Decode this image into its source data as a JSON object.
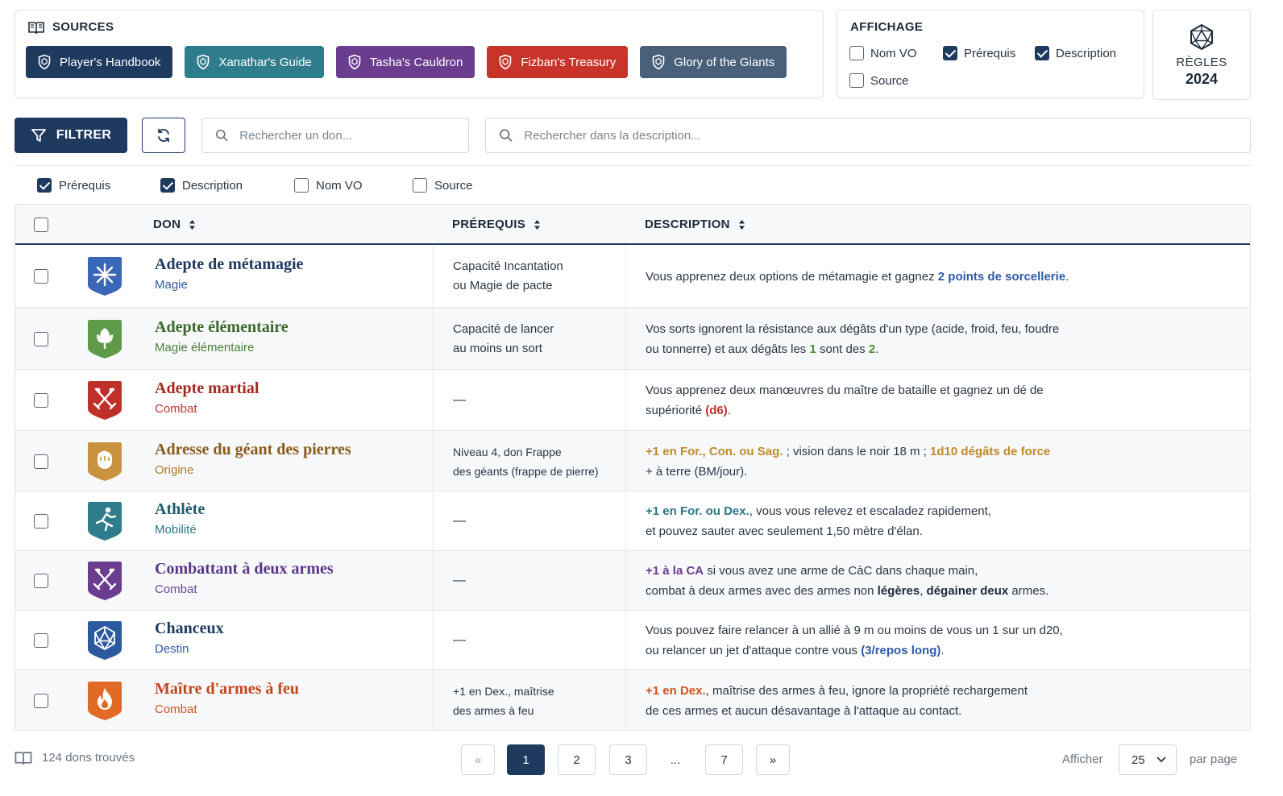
{
  "sources": {
    "title": "SOURCES",
    "buttons": [
      {
        "label": "Player's Handbook",
        "color": "#1f3a5f"
      },
      {
        "label": "Xanathar's Guide",
        "color": "#2f7d8c"
      },
      {
        "label": "Tasha's Cauldron",
        "color": "#6a3d8f"
      },
      {
        "label": "Fizban's Treasury",
        "color": "#c9342a"
      },
      {
        "label": "Glory of the Giants",
        "color": "#48607a"
      }
    ]
  },
  "affichage": {
    "title": "AFFICHAGE",
    "options": [
      {
        "label": "Nom VO",
        "checked": false
      },
      {
        "label": "Prérequis",
        "checked": true
      },
      {
        "label": "Description",
        "checked": true
      },
      {
        "label": "Source",
        "checked": false
      }
    ]
  },
  "regles": {
    "label": "RÈGLES",
    "year": "2024"
  },
  "toolbar": {
    "filter_label": "FILTRER",
    "search_don_placeholder": "Rechercher un don...",
    "search_desc_placeholder": "Rechercher dans la description..."
  },
  "column_toggles": [
    {
      "label": "Prérequis",
      "checked": true
    },
    {
      "label": "Description",
      "checked": true
    },
    {
      "label": "Nom VO",
      "checked": false
    },
    {
      "label": "Source",
      "checked": false
    }
  ],
  "table": {
    "headers": {
      "don": "DON",
      "prerequis": "PRÉREQUIS",
      "description": "DESCRIPTION"
    },
    "rows": [
      {
        "name": "Adepte de métamagie",
        "category": "Magie",
        "name_color": "#1f3a5f",
        "cat_color": "#2f5aa8",
        "icon_color": "#3b67b8",
        "icon": "sparkle-icon",
        "prereq": [
          "Capacité Incantation",
          "ou Magie de pacte"
        ],
        "desc": [
          [
            {
              "t": "Vous apprenez deux options de métamagie et gagnez "
            },
            {
              "t": "2 points de sorcellerie",
              "c": "#2f5aa8"
            },
            {
              "t": "."
            }
          ]
        ]
      },
      {
        "name": "Adepte élémentaire",
        "category": "Magie élémentaire",
        "name_color": "#3c6a2c",
        "cat_color": "#4b7f36",
        "icon_color": "#5e9a48",
        "icon": "leaf-icon",
        "prereq": [
          "Capacité de lancer",
          "au moins un sort"
        ],
        "desc": [
          [
            {
              "t": "Vos sorts ignorent la résistance aux dégâts d'un type (acide, froid, feu, foudre"
            }
          ],
          [
            {
              "t": "ou tonnerre) et aux dégâts les "
            },
            {
              "t": "1",
              "c": "#4b8f36"
            },
            {
              "t": " sont des "
            },
            {
              "t": "2",
              "c": "#4b8f36"
            },
            {
              "t": "."
            }
          ]
        ]
      },
      {
        "name": "Adepte martial",
        "category": "Combat",
        "name_color": "#a32a22",
        "cat_color": "#b8362c",
        "icon_color": "#c0302a",
        "icon": "crossed-swords-icon",
        "prereq": [
          "—"
        ],
        "desc": [
          [
            {
              "t": "Vous apprenez deux manœuvres du maître de bataille et gagnez un dé de"
            }
          ],
          [
            {
              "t": "supériorité "
            },
            {
              "t": "(d6)",
              "c": "#b8362c"
            },
            {
              "t": "."
            }
          ]
        ]
      },
      {
        "name": "Adresse du géant des pierres",
        "category": "Origine",
        "name_color": "#8a5a1a",
        "cat_color": "#b07a28",
        "icon_color": "#c9923f",
        "icon": "stone-fist-icon",
        "prereq": [
          "Niveau 4, don Frappe",
          "des géants (frappe de pierre)"
        ],
        "desc": [
          [
            {
              "t": "+1 en For., Con. ou Sag.",
              "c": "#c08a2a"
            },
            {
              "t": " ; vision dans le noir 18 m ; "
            },
            {
              "t": "1d10 dégâts de force",
              "c": "#c08a2a"
            }
          ],
          [
            {
              "t": "+ à terre (BM/jour)."
            }
          ]
        ]
      },
      {
        "name": "Athlète",
        "category": "Mobilité",
        "name_color": "#1f5a6e",
        "cat_color": "#2d7487",
        "icon_color": "#2f7d8c",
        "icon": "runner-icon",
        "prereq": [
          "—"
        ],
        "desc": [
          [
            {
              "t": "+1 en For. ou Dex.",
              "c": "#2d7487"
            },
            {
              "t": ", vous vous relevez et escaladez rapidement,"
            }
          ],
          [
            {
              "t": "et pouvez sauter avec seulement 1,50 mètre d'élan."
            }
          ]
        ]
      },
      {
        "name": "Combattant à deux armes",
        "category": "Combat",
        "name_color": "#5a3685",
        "cat_color": "#6a4a95",
        "icon_color": "#6a3d8f",
        "icon": "dual-swords-icon",
        "prereq": [
          "—"
        ],
        "desc": [
          [
            {
              "t": "+1 à la CA",
              "c": "#6a3d8f"
            },
            {
              "t": " si vous avez une arme de CàC dans chaque main,"
            }
          ],
          [
            {
              "t": "combat à deux armes avec des armes non "
            },
            {
              "t": "légères",
              "c": "#1e2a3a"
            },
            {
              "t": ", "
            },
            {
              "t": "dégainer deux",
              "c": "#1e2a3a"
            },
            {
              "t": " armes."
            }
          ]
        ]
      },
      {
        "name": "Chanceux",
        "category": "Destin",
        "name_color": "#1f3a5f",
        "cat_color": "#2f5aa8",
        "icon_color": "#2c5a9e",
        "icon": "d20-icon",
        "prereq": [
          "—"
        ],
        "desc": [
          [
            {
              "t": "Vous pouvez faire relancer à un allié à 9 m ou moins de vous un 1 sur un d20,"
            }
          ],
          [
            {
              "t": "ou relancer un jet d'attaque contre vous "
            },
            {
              "t": "(3/repos long)",
              "c": "#2f5aa8"
            },
            {
              "t": "."
            }
          ]
        ]
      },
      {
        "name": "Maître d'armes à feu",
        "category": "Combat",
        "name_color": "#c2451a",
        "cat_color": "#c9551f",
        "icon_color": "#e06a26",
        "icon": "flame-icon",
        "prereq": [
          "+1 en Dex., maîtrise",
          "des armes à feu"
        ],
        "desc": [
          [
            {
              "t": "+1 en Dex.",
              "c": "#d2541c"
            },
            {
              "t": ", maîtrise des armes à feu, ignore la propriété rechargement"
            }
          ],
          [
            {
              "t": "de ces armes et aucun désavantage à l'attaque au contact."
            }
          ]
        ]
      }
    ]
  },
  "footer": {
    "count_text": "124 dons trouvés",
    "pages": [
      "«",
      "1",
      "2",
      "3",
      "...",
      "7",
      "»"
    ],
    "active_page": "1",
    "afficher_label": "Afficher",
    "per_page": "25",
    "par_page_label": "par page"
  }
}
